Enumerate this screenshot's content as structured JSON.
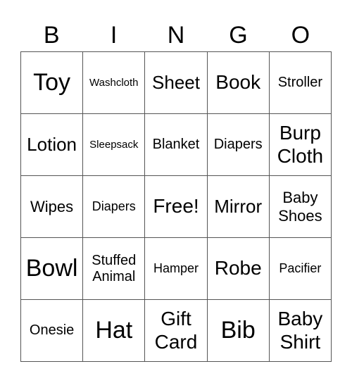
{
  "header": [
    "B",
    "I",
    "N",
    "G",
    "O"
  ],
  "cells": [
    [
      "Toy",
      "Washcloth",
      "Sheet",
      "Book",
      "Stroller"
    ],
    [
      "Lotion",
      "Sleepsack",
      "Blanket",
      "Diapers",
      "Burp Cloth"
    ],
    [
      "Wipes",
      "Diapers",
      "Free!",
      "Mirror",
      "Baby Shoes"
    ],
    [
      "Bowl",
      "Stuffed Animal",
      "Hamper",
      "Robe",
      "Pacifier"
    ],
    [
      "Onesie",
      "Hat",
      "Gift Card",
      "Bib",
      "Baby Shirt"
    ]
  ]
}
